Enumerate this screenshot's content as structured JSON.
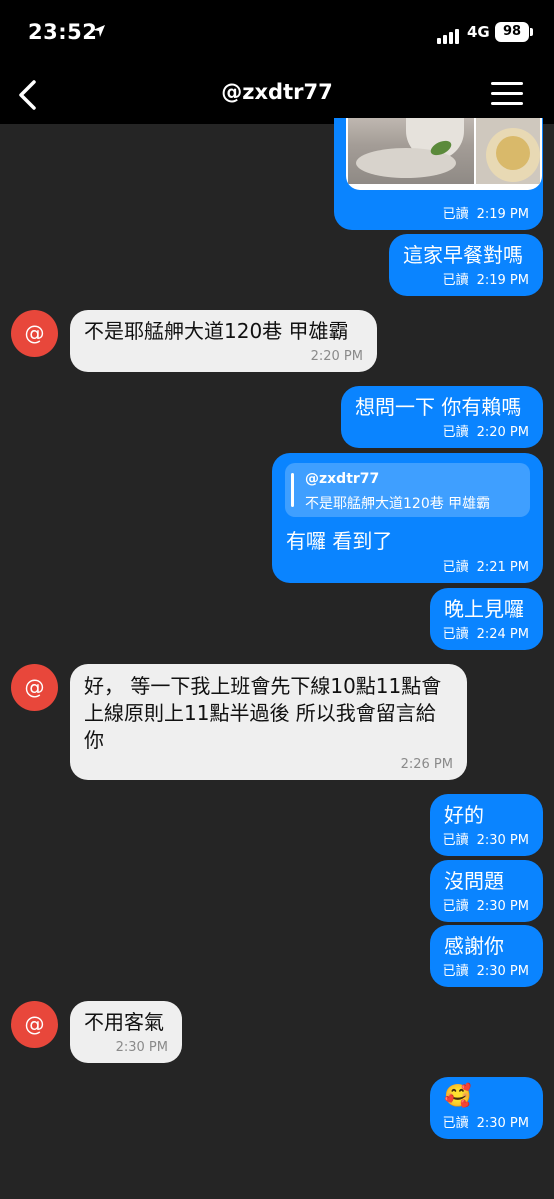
{
  "status_bar": {
    "time": "23:52",
    "network": "4G",
    "battery": "98"
  },
  "nav": {
    "title": "@zxdtr77"
  },
  "reply_quote": {
    "name": "@zxdtr77",
    "text": "不是耶艋舺大道120巷 甲雄霸"
  },
  "messages": [
    {
      "dir": "out",
      "text": "",
      "read": "已讀",
      "time": "2:19 PM",
      "kind": "image"
    },
    {
      "dir": "out",
      "text": "這家早餐對嗎",
      "read": "已讀",
      "time": "2:19 PM"
    },
    {
      "dir": "in",
      "text": "不是耶艋舺大道120巷 甲雄霸",
      "time": "2:20 PM"
    },
    {
      "dir": "out",
      "text": "想問一下 你有賴嗎",
      "read": "已讀",
      "time": "2:20 PM"
    },
    {
      "dir": "out",
      "text": "有囉 看到了",
      "read": "已讀",
      "time": "2:21 PM",
      "kind": "reply"
    },
    {
      "dir": "out",
      "text": "晚上見囉",
      "read": "已讀",
      "time": "2:24 PM"
    },
    {
      "dir": "in",
      "text": "好，  等一下我上班會先下線10點11點會上線原則上11點半過後 所以我會留言給你",
      "time": "2:26 PM"
    },
    {
      "dir": "out",
      "text": "好的",
      "read": "已讀",
      "time": "2:30 PM"
    },
    {
      "dir": "out",
      "text": "沒問題",
      "read": "已讀",
      "time": "2:30 PM"
    },
    {
      "dir": "out",
      "text": "感謝你",
      "read": "已讀",
      "time": "2:30 PM"
    },
    {
      "dir": "in",
      "text": "不用客氣",
      "time": "2:30 PM"
    },
    {
      "dir": "out",
      "text": "🥰",
      "read": "已讀",
      "time": "2:30 PM"
    }
  ],
  "avatar_symbol": "@",
  "icons": [
    "location-arrow-icon",
    "signal-icon",
    "battery-icon",
    "back-chevron-icon",
    "hamburger-menu-icon"
  ],
  "colors": {
    "outgoing_bubble": "#0a84ff",
    "incoming_bubble": "#efefef",
    "avatar": "#e8473b",
    "background": "#252525"
  }
}
